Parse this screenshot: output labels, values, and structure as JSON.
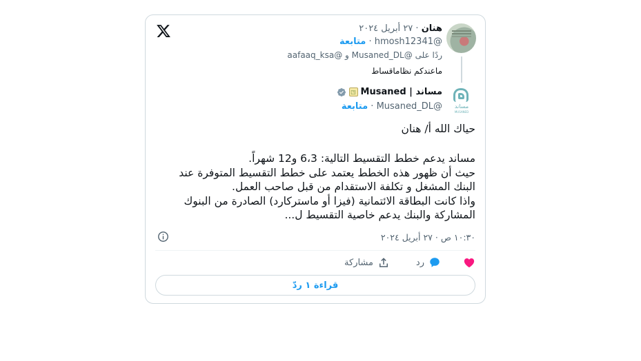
{
  "reply_tweet": {
    "author_name": "هنان",
    "date": "٢٧ أبريل ٢٠٢٤",
    "handle": "@hmosh12341",
    "follow_label": "متابعة",
    "replying_to": "ردًا على @Musaned_DL و @aafaaq_ksa",
    "text": "ماعندكم نظاماقساط"
  },
  "main_tweet": {
    "author_name": "مساند | Musaned",
    "handle": "@Musaned_DL",
    "follow_label": "متابعة",
    "greeting": "حياك الله أ/ هنان",
    "body": "مساند يدعم خطط التقسيط التالية: 6،3 و12 شهراً.\nحيث أن ظهور هذه الخطط يعتمد على خطط التقسيط المتوفرة عند البنك المشغل و تكلفة الاستقدام من قبل صاحب العمل.\nواذا كانت البطاقة الائتمانية (فيزا أو ماستركارد) الصادرة من البنوك المشاركة والبنك يدعم خاصية التقسيط ل...",
    "timestamp": "١٠:٣٠ ص · ٢٧ أبريل ٢٠٢٤",
    "avatar_text": "مساند",
    "avatar_sub": "MUSANED"
  },
  "actions": {
    "reply_label": "رد",
    "share_label": "مشاركة"
  },
  "read_replies_label": "قراءة ١ ردّ",
  "colors": {
    "accent": "#1d9bf0",
    "like": "#f91880",
    "muted": "#536471",
    "border": "#cfd9de"
  },
  "icons": [
    "x-logo-icon",
    "verified-badge-icon",
    "affiliate-badge-icon",
    "info-icon",
    "heart-icon",
    "reply-bubble-icon",
    "share-icon"
  ]
}
